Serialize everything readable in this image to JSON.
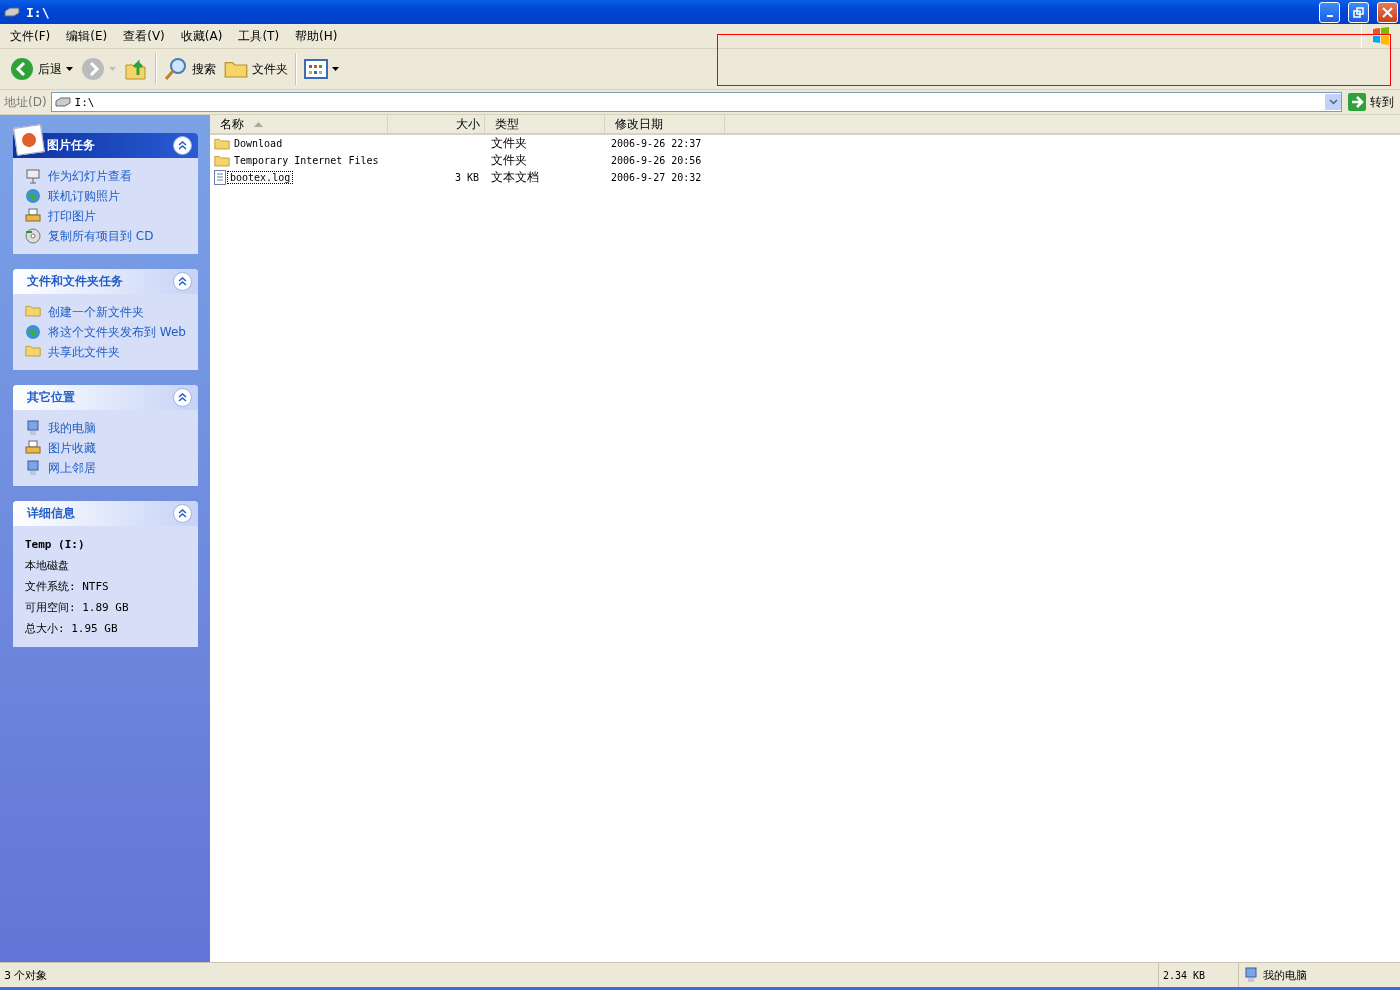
{
  "window": {
    "title": "I:\\"
  },
  "menu": [
    {
      "label": "文件(F)"
    },
    {
      "label": "编辑(E)"
    },
    {
      "label": "查看(V)"
    },
    {
      "label": "收藏(A)"
    },
    {
      "label": "工具(T)"
    },
    {
      "label": "帮助(H)"
    }
  ],
  "toolbar": [
    {
      "kind": "back",
      "label": "后退",
      "disabled": false
    },
    {
      "kind": "forward",
      "disabled": true
    },
    {
      "kind": "up"
    },
    {
      "kind": "search",
      "label": "搜索"
    },
    {
      "kind": "folders",
      "label": "文件夹"
    },
    {
      "kind": "views"
    }
  ],
  "address": {
    "label": "地址(D)",
    "value": "I:\\",
    "go": "转到"
  },
  "sidebar": [
    {
      "title": "图片任务",
      "kind": "special",
      "expanded": true,
      "items": [
        {
          "label": "作为幻灯片查看"
        },
        {
          "label": "联机订购照片"
        },
        {
          "label": "打印图片"
        },
        {
          "label": "复制所有项目到 CD"
        }
      ]
    },
    {
      "title": "文件和文件夹任务",
      "kind": "normal",
      "expanded": true,
      "items": [
        {
          "label": "创建一个新文件夹"
        },
        {
          "label": "将这个文件夹发布到 Web"
        },
        {
          "label": "共享此文件夹"
        }
      ]
    },
    {
      "title": "其它位置",
      "kind": "normal",
      "expanded": true,
      "items": [
        {
          "label": "我的电脑"
        },
        {
          "label": "图片收藏"
        },
        {
          "label": "网上邻居"
        }
      ]
    },
    {
      "title": "详细信息",
      "kind": "details",
      "expanded": true,
      "lines": [
        {
          "text": "Temp (I:)",
          "bold": true
        },
        {
          "text": "本地磁盘",
          "bold": false
        },
        {
          "text": "文件系统: NTFS",
          "bold": false
        },
        {
          "text": "可用空间: 1.89 GB",
          "bold": false
        },
        {
          "text": "总大小: 1.95 GB",
          "bold": false
        }
      ]
    }
  ],
  "table": {
    "columns": [
      {
        "label": "名称",
        "sorted": true
      },
      {
        "label": "大小",
        "sorted": false
      },
      {
        "label": "类型",
        "sorted": false
      },
      {
        "label": "修改日期",
        "sorted": false
      }
    ],
    "rows": [
      {
        "kind": "folder",
        "name": "Download",
        "size": "",
        "type": "文件夹",
        "modified": "2006-9-26 22:37",
        "focused": false
      },
      {
        "kind": "folder",
        "name": "Temporary Internet Files",
        "size": "",
        "type": "文件夹",
        "modified": "2006-9-26 20:56",
        "focused": false
      },
      {
        "kind": "file",
        "name": "bootex.log",
        "size": "3 KB",
        "type": "文本文档",
        "modified": "2006-9-27 20:32",
        "focused": true
      }
    ]
  },
  "status_bar": {
    "objects": "3 个对象",
    "size": "2.34 KB",
    "location": "我的电脑"
  }
}
